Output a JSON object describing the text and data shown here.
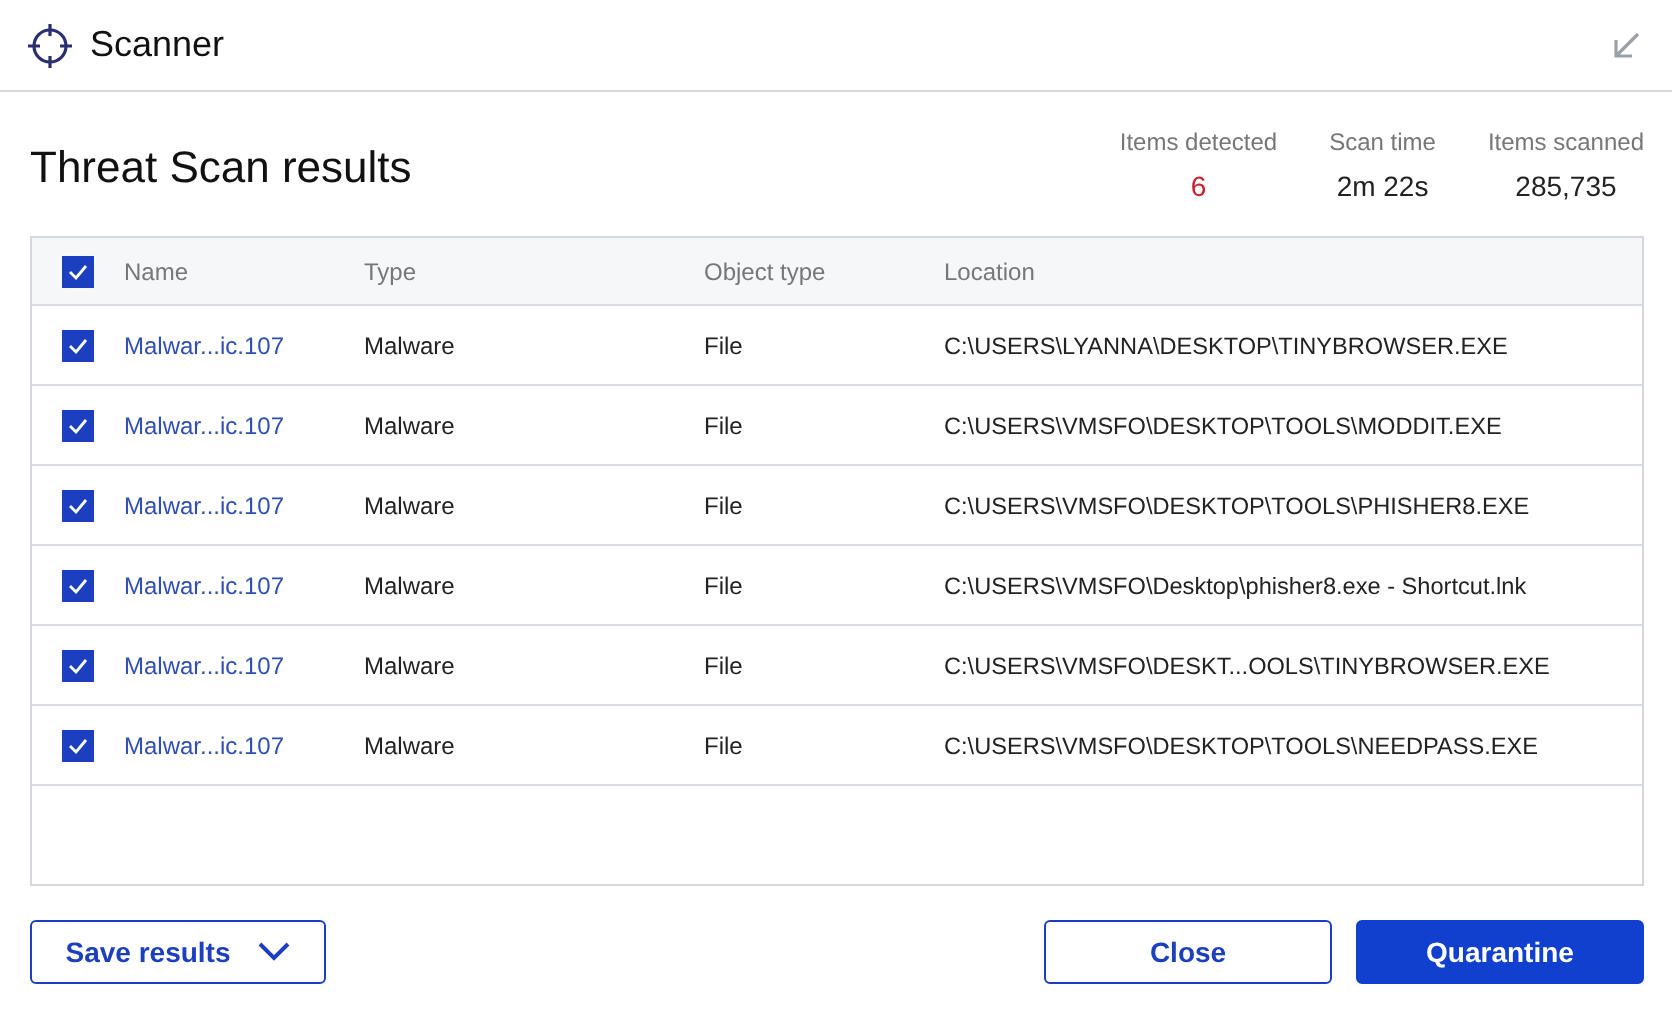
{
  "window": {
    "title": "Scanner"
  },
  "heading": "Threat Scan results",
  "stats": [
    {
      "label": "Items detected",
      "value": "6",
      "kind": "alert"
    },
    {
      "label": "Scan time",
      "value": "2m 22s",
      "kind": "plain"
    },
    {
      "label": "Items scanned",
      "value": "285,735",
      "kind": "plain"
    }
  ],
  "table": {
    "all_checked": true,
    "columns": [
      "Name",
      "Type",
      "Object type",
      "Location"
    ],
    "rows": [
      {
        "checked": true,
        "name": "Malwar...ic.107",
        "type": "Malware",
        "object_type": "File",
        "location": "C:\\USERS\\LYANNA\\DESKTOP\\TINYBROWSER.EXE"
      },
      {
        "checked": true,
        "name": "Malwar...ic.107",
        "type": "Malware",
        "object_type": "File",
        "location": "C:\\USERS\\VMSFO\\DESKTOP\\TOOLS\\MODDIT.EXE"
      },
      {
        "checked": true,
        "name": "Malwar...ic.107",
        "type": "Malware",
        "object_type": "File",
        "location": "C:\\USERS\\VMSFO\\DESKTOP\\TOOLS\\PHISHER8.EXE"
      },
      {
        "checked": true,
        "name": "Malwar...ic.107",
        "type": "Malware",
        "object_type": "File",
        "location": "C:\\USERS\\VMSFO\\Desktop\\phisher8.exe - Shortcut.lnk"
      },
      {
        "checked": true,
        "name": "Malwar...ic.107",
        "type": "Malware",
        "object_type": "File",
        "location": "C:\\USERS\\VMSFO\\DESKT...OOLS\\TINYBROWSER.EXE"
      },
      {
        "checked": true,
        "name": "Malwar...ic.107",
        "type": "Malware",
        "object_type": "File",
        "location": "C:\\USERS\\VMSFO\\DESKTOP\\TOOLS\\NEEDPASS.EXE"
      }
    ]
  },
  "buttons": {
    "save": "Save results",
    "close": "Close",
    "quarantine": "Quarantine"
  }
}
